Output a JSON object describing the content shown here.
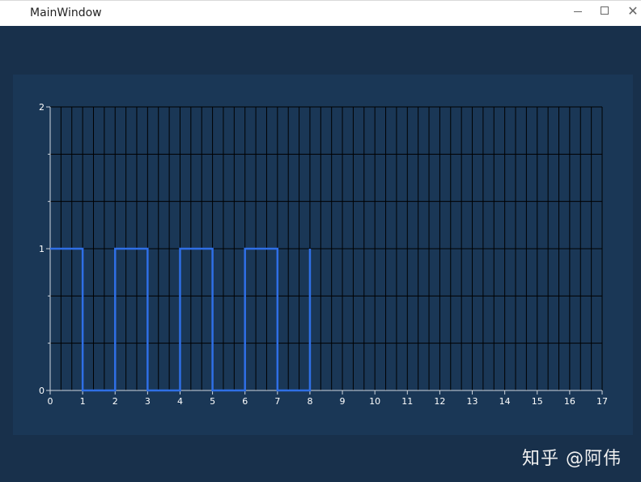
{
  "window": {
    "title": "MainWindow",
    "minimize_glyph": "—",
    "maximize_glyph": "☐",
    "close_glyph": "✕"
  },
  "colors": {
    "client_background": "#18304b",
    "plot_background": "#1a3756",
    "grid_line": "#000000",
    "axis_line": "#cfd6de",
    "tick_label": "#ffffff",
    "signal": "#2f6fe6"
  },
  "chart_data": {
    "type": "line",
    "title": "",
    "xlabel": "",
    "ylabel": "",
    "step": true,
    "xlim": [
      0,
      17
    ],
    "ylim": [
      0,
      2
    ],
    "x_ticks": [
      0,
      1,
      2,
      3,
      4,
      5,
      6,
      7,
      8,
      9,
      10,
      11,
      12,
      13,
      14,
      15,
      16,
      17
    ],
    "y_ticks": [
      0,
      1,
      2
    ],
    "grid": true,
    "legend": "none",
    "series": [
      {
        "x": [
          0,
          1,
          1,
          2,
          2,
          3,
          3,
          4,
          4,
          5,
          5,
          6,
          6,
          7,
          7,
          8,
          8
        ],
        "y": [
          1,
          1,
          0,
          0,
          1,
          1,
          0,
          0,
          1,
          1,
          0,
          0,
          1,
          1,
          0,
          0,
          1
        ]
      }
    ]
  },
  "watermark": {
    "text": "知乎 @阿伟"
  }
}
